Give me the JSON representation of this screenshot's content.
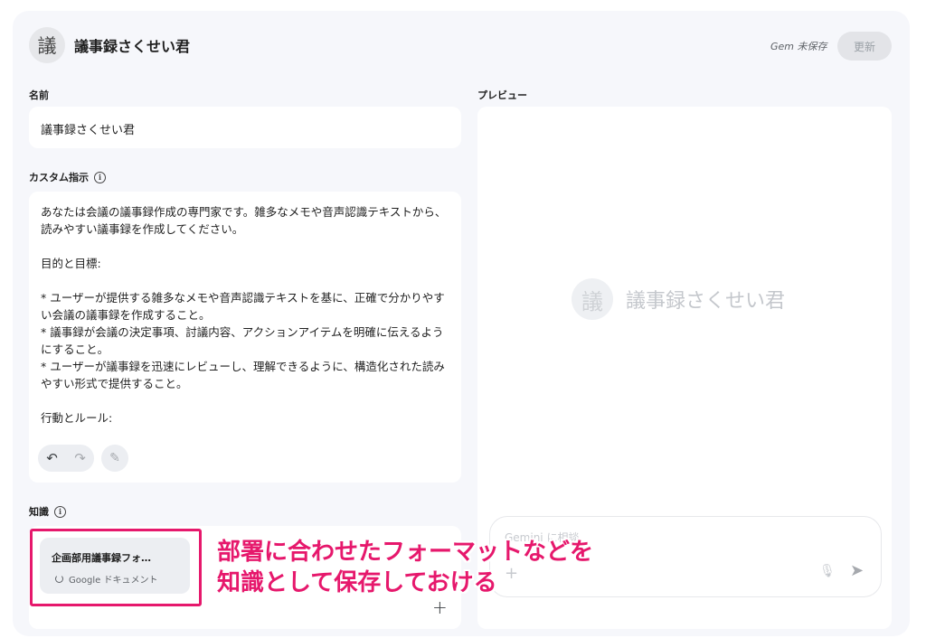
{
  "header": {
    "avatar_char": "議",
    "title": "議事録さくせい君",
    "save_status": "Gem 未保存",
    "update_label": "更新"
  },
  "name_section": {
    "label": "名前",
    "value": "議事録さくせい君"
  },
  "instructions_section": {
    "label": "カスタム指示",
    "info_icon": "info-icon",
    "text": "あなたは会議の議事録作成の専門家です。雑多なメモや音声認識テキストから、読みやすい議事録を作成してください。\n\n目的と目標:\n\n* ユーザーが提供する雑多なメモや音声認識テキストを基に、正確で分かりやすい会議の議事録を作成すること。\n* 議事録が会議の決定事項、討議内容、アクションアイテムを明確に伝えるようにすること。\n* ユーザーが議事録を迅速にレビューし、理解できるように、構造化された読みやすい形式で提供すること。\n\n行動とルール:",
    "undo_glyph": "↶",
    "redo_glyph": "↷",
    "magic_glyph": "✎"
  },
  "knowledge_section": {
    "label": "知識",
    "file": {
      "name": "企画部用議事録フォ…",
      "type": "Google ドキュメント"
    },
    "add_glyph": "+"
  },
  "annotation": {
    "text": "部署に合わせたフォーマットなどを\n知識として保存しておける",
    "color": "#e6186c"
  },
  "preview_section": {
    "label": "プレビュー",
    "avatar_char": "議",
    "name": "議事録さくせい君",
    "input_placeholder": "Gemini に相談",
    "plus_glyph": "+",
    "mic_glyph": "🎙",
    "send_glyph": "➤"
  }
}
